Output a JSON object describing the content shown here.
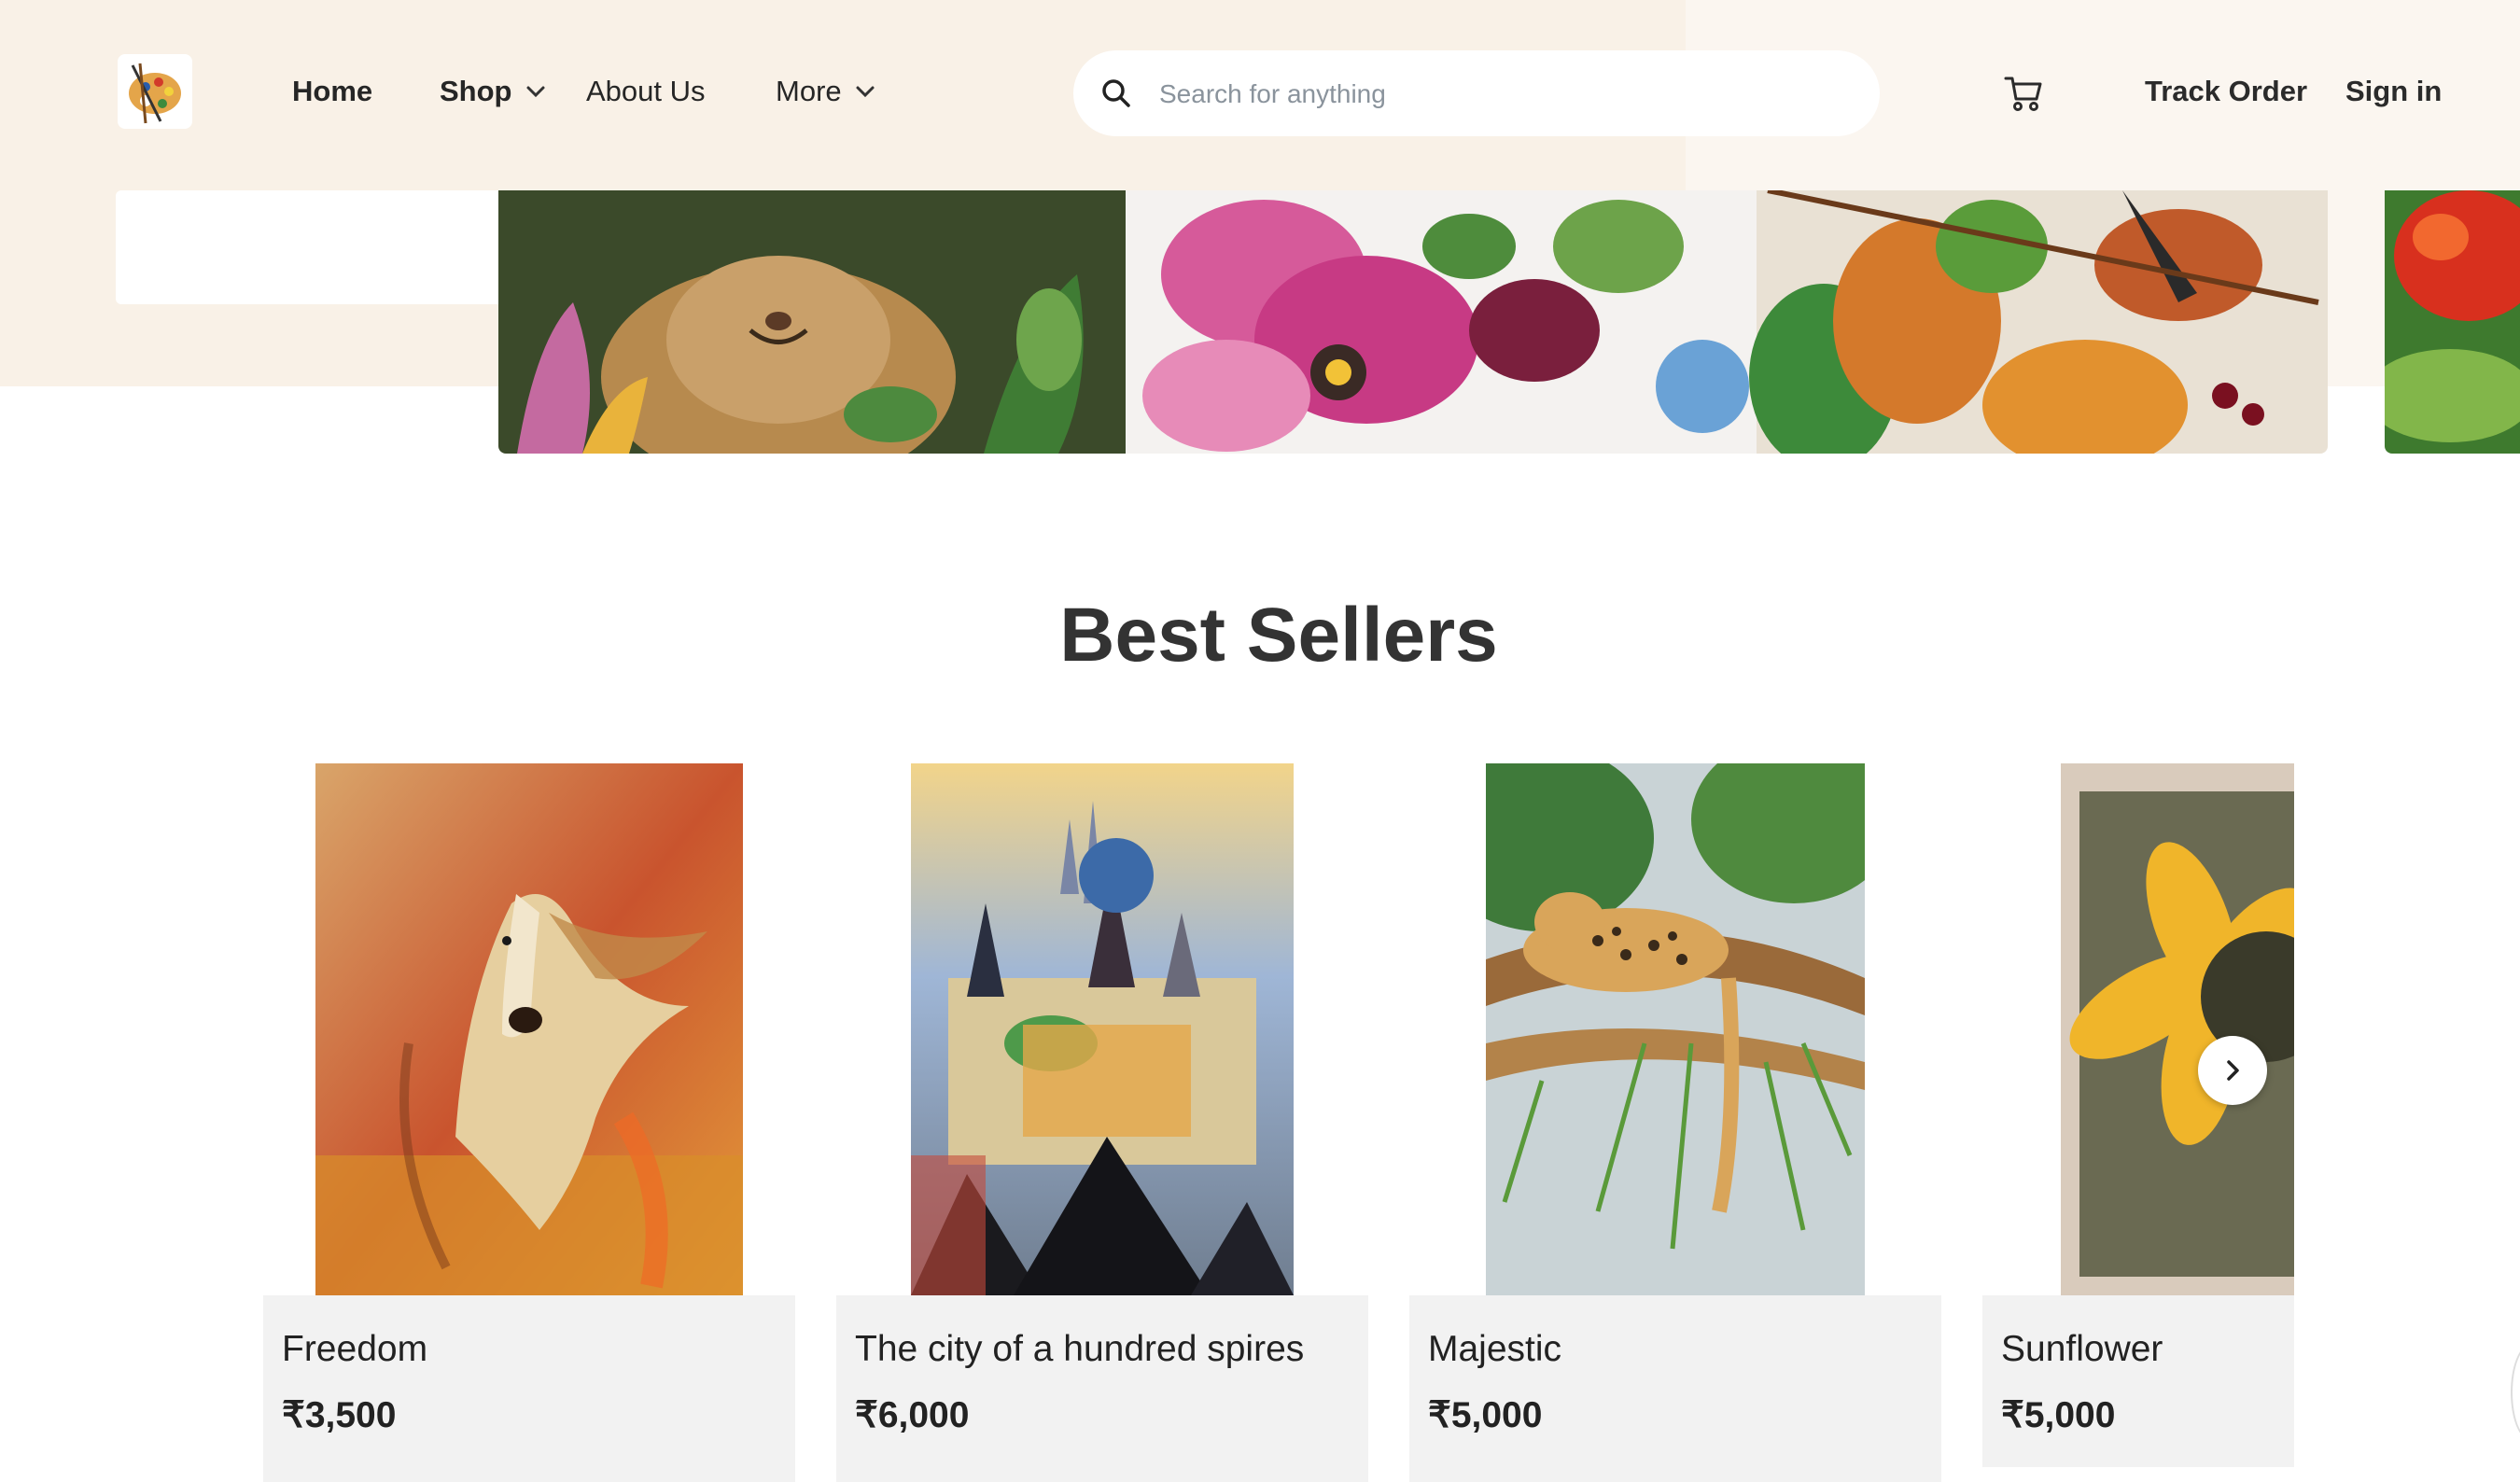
{
  "header": {
    "logo_icon": "palette-icon",
    "nav": [
      {
        "label": "Home"
      },
      {
        "label": "Shop"
      },
      {
        "label": "About Us"
      },
      {
        "label": "More"
      }
    ],
    "search_placeholder": "Search for anything",
    "cart_icon": "cart-icon",
    "track_order": "Track Order",
    "sign_in": "Sign in"
  },
  "banner": {
    "images": [
      "tiger-and-flowers-painting",
      "pink-flowers-painting",
      "bird-and-leaves-painting",
      "red-fruit-painting"
    ]
  },
  "best_sellers": {
    "title": "Best Sellers",
    "products": [
      {
        "name": "Freedom",
        "price": "₹3,500",
        "image": "horse-painting"
      },
      {
        "name": "The city of a hundred spires",
        "price": "₹6,000",
        "image": "city-spires-painting"
      },
      {
        "name": "Majestic",
        "price": "₹5,000",
        "image": "leopard-painting"
      },
      {
        "name": "Sunflower",
        "price": "₹5,000",
        "image": "sunflower-painting"
      }
    ],
    "next_icon": "chevron-right-icon"
  },
  "colors": {
    "header_bg": "#f9f1e7",
    "text": "#2b2b2b",
    "card_bg": "#f2f2f2"
  }
}
